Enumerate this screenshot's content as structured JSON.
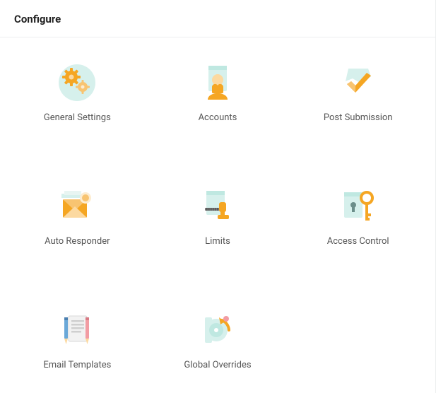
{
  "header": {
    "title": "Configure"
  },
  "tiles": [
    {
      "label": "General Settings"
    },
    {
      "label": "Accounts"
    },
    {
      "label": "Post Submission"
    },
    {
      "label": "Auto Responder"
    },
    {
      "label": "Limits"
    },
    {
      "label": "Access Control"
    },
    {
      "label": "Email Templates"
    },
    {
      "label": "Global Overrides"
    }
  ],
  "colors": {
    "teal_light": "#d6f0ec",
    "teal": "#bfe8e1",
    "orange": "#f5a623",
    "orange_light": "#f8c471",
    "orange_pale": "#fcd9a0",
    "pink": "#f29ca3",
    "blue": "#6aa8d8",
    "gray": "#e6e6e6"
  }
}
